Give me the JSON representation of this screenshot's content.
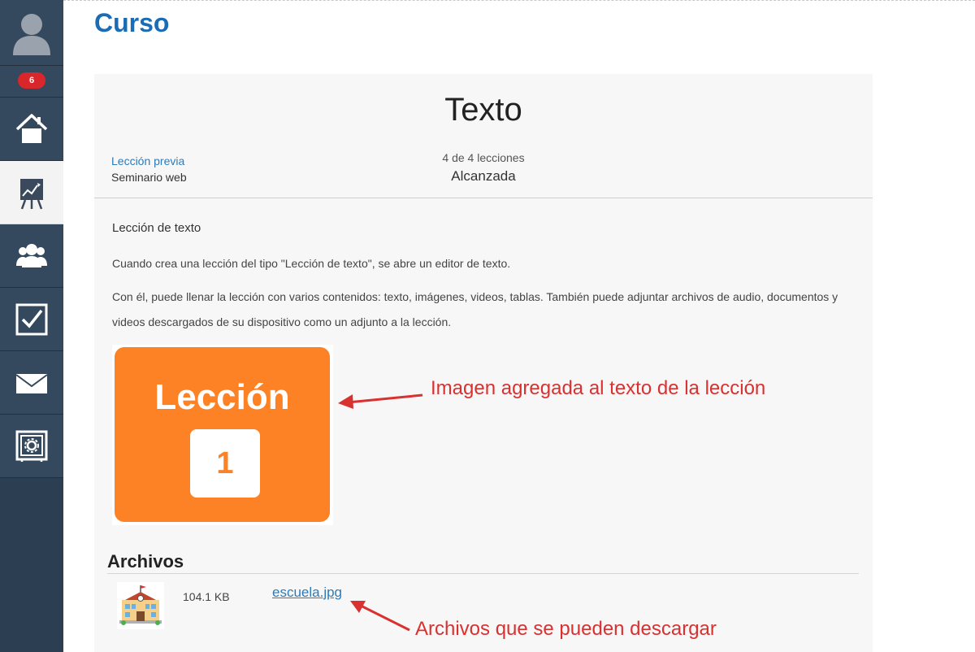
{
  "header": {
    "title": "Curso"
  },
  "sidebar": {
    "badge_count": "6",
    "items": [
      {
        "name": "home",
        "icon": "home-icon"
      },
      {
        "name": "courses",
        "icon": "presentation-chart-icon",
        "active": true
      },
      {
        "name": "groups",
        "icon": "users-icon"
      },
      {
        "name": "tasks",
        "icon": "checkbox-icon"
      },
      {
        "name": "messages",
        "icon": "envelope-icon"
      },
      {
        "name": "settings",
        "icon": "safe-gear-icon"
      }
    ]
  },
  "lesson": {
    "title": "Texto",
    "prev_label": "Lección previa",
    "prev_name": "Seminario web",
    "progress": "4 de 4 lecciones",
    "status": "Alcanzada",
    "subtitle": "Lección de texto",
    "paragraph1": "Cuando crea una lección del tipo \"Lección de texto\", se abre un editor de texto.",
    "paragraph2": "Con él, puede llenar la lección con varios contenidos: texto, imágenes, videos, tablas. También puede adjuntar archivos de audio, documentos y videos descargados de su dispositivo como un adjunto a la lección.",
    "image": {
      "word": "Lección",
      "number": "1",
      "color": "#fd8225"
    }
  },
  "files": {
    "heading": "Archivos",
    "items": [
      {
        "size": "104.1 KB",
        "name": "escuela.jpg",
        "icon": "school-building-icon"
      }
    ]
  },
  "annotations": {
    "image_note": "Imagen agregada al texto de la lección",
    "files_note": "Archivos que se pueden descargar",
    "color": "#d93030"
  },
  "colors": {
    "accent": "#1a6db5",
    "link": "#2d7bb8",
    "sidebar": "#34495e",
    "badge": "#d9262b"
  }
}
